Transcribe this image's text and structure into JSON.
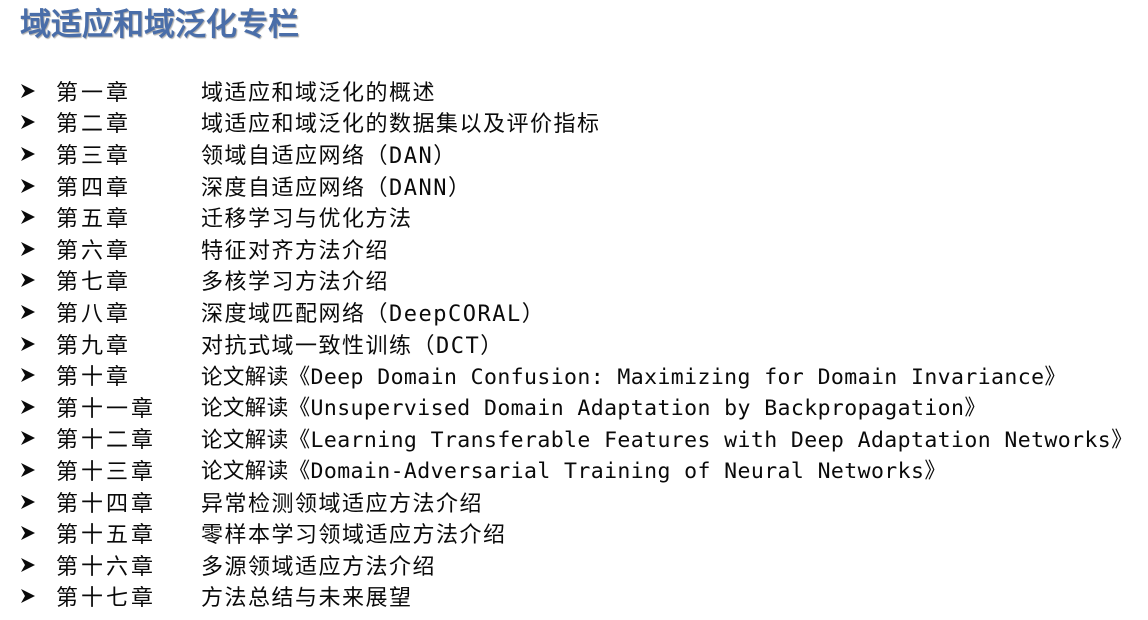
{
  "title": "域适应和域泛化专栏",
  "colors": {
    "title": "#4a6ea9",
    "text": "#0a0a0a"
  },
  "bullet_icon": "arrowhead-bullet-icon",
  "chapters": [
    {
      "chapter": "第一章",
      "topic": "域适应和域泛化的概述"
    },
    {
      "chapter": "第二章",
      "topic": "域适应和域泛化的数据集以及评价指标"
    },
    {
      "chapter": "第三章",
      "topic": "领域自适应网络（DAN）"
    },
    {
      "chapter": "第四章",
      "topic": "深度自适应网络（DANN）"
    },
    {
      "chapter": "第五章",
      "topic": "迁移学习与优化方法"
    },
    {
      "chapter": "第六章",
      "topic": "特征对齐方法介绍"
    },
    {
      "chapter": "第七章",
      "topic": "多核学习方法介绍"
    },
    {
      "chapter": "第八章",
      "topic": "深度域匹配网络（DeepCORAL）"
    },
    {
      "chapter": "第九章",
      "topic": "对抗式域一致性训练（DCT）"
    },
    {
      "chapter": "第十章",
      "topic": "论文解读《Deep Domain Confusion: Maximizing for Domain Invariance》"
    },
    {
      "chapter": "第十一章",
      "topic": "论文解读《Unsupervised Domain Adaptation by Backpropagation》"
    },
    {
      "chapter": "第十二章",
      "topic": "论文解读《Learning Transferable Features with Deep Adaptation Networks》"
    },
    {
      "chapter": "第十三章",
      "topic": "论文解读《Domain-Adversarial Training of Neural Networks》"
    },
    {
      "chapter": "第十四章",
      "topic": "异常检测领域适应方法介绍"
    },
    {
      "chapter": "第十五章",
      "topic": "零样本学习领域适应方法介绍"
    },
    {
      "chapter": "第十六章",
      "topic": "多源领域适应方法介绍"
    },
    {
      "chapter": "第十七章",
      "topic": "方法总结与未来展望"
    }
  ]
}
